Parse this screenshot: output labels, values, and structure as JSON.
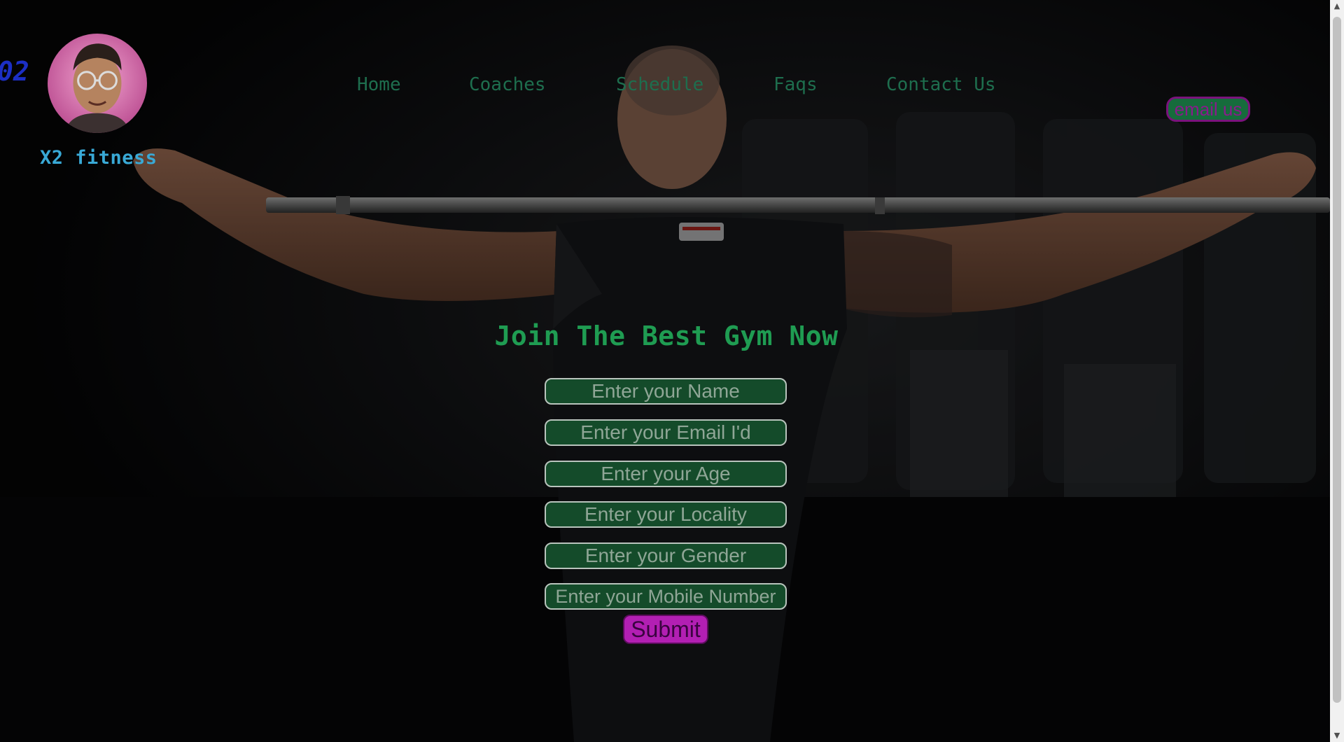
{
  "brand": {
    "name": "X2 fitness",
    "overlay_glyph": "02"
  },
  "nav": {
    "items": [
      {
        "label": "Home"
      },
      {
        "label": "Coaches"
      },
      {
        "label": "Schedule"
      },
      {
        "label": "Faqs"
      },
      {
        "label": "Contact Us"
      }
    ]
  },
  "header": {
    "email_button_label": "email us"
  },
  "form": {
    "title": "Join The Best Gym Now",
    "fields": [
      {
        "placeholder": "Enter your Name"
      },
      {
        "placeholder": "Enter your Email I'd"
      },
      {
        "placeholder": "Enter your Age"
      },
      {
        "placeholder": "Enter your Locality"
      },
      {
        "placeholder": "Enter your Gender"
      },
      {
        "placeholder": "Enter your Mobile Number"
      }
    ],
    "submit_label": "Submit"
  },
  "colors": {
    "nav_link": "#1e6e4e",
    "brand_name": "#39a9d6",
    "title": "#1f9c52",
    "field_bg": "#144b2a",
    "submit_bg": "#b21fb3",
    "email_bg": "#166c3c"
  },
  "icons": {
    "logo": "avatar-photo",
    "scroll_up": "arrow-up-icon",
    "scroll_down": "arrow-down-icon"
  }
}
